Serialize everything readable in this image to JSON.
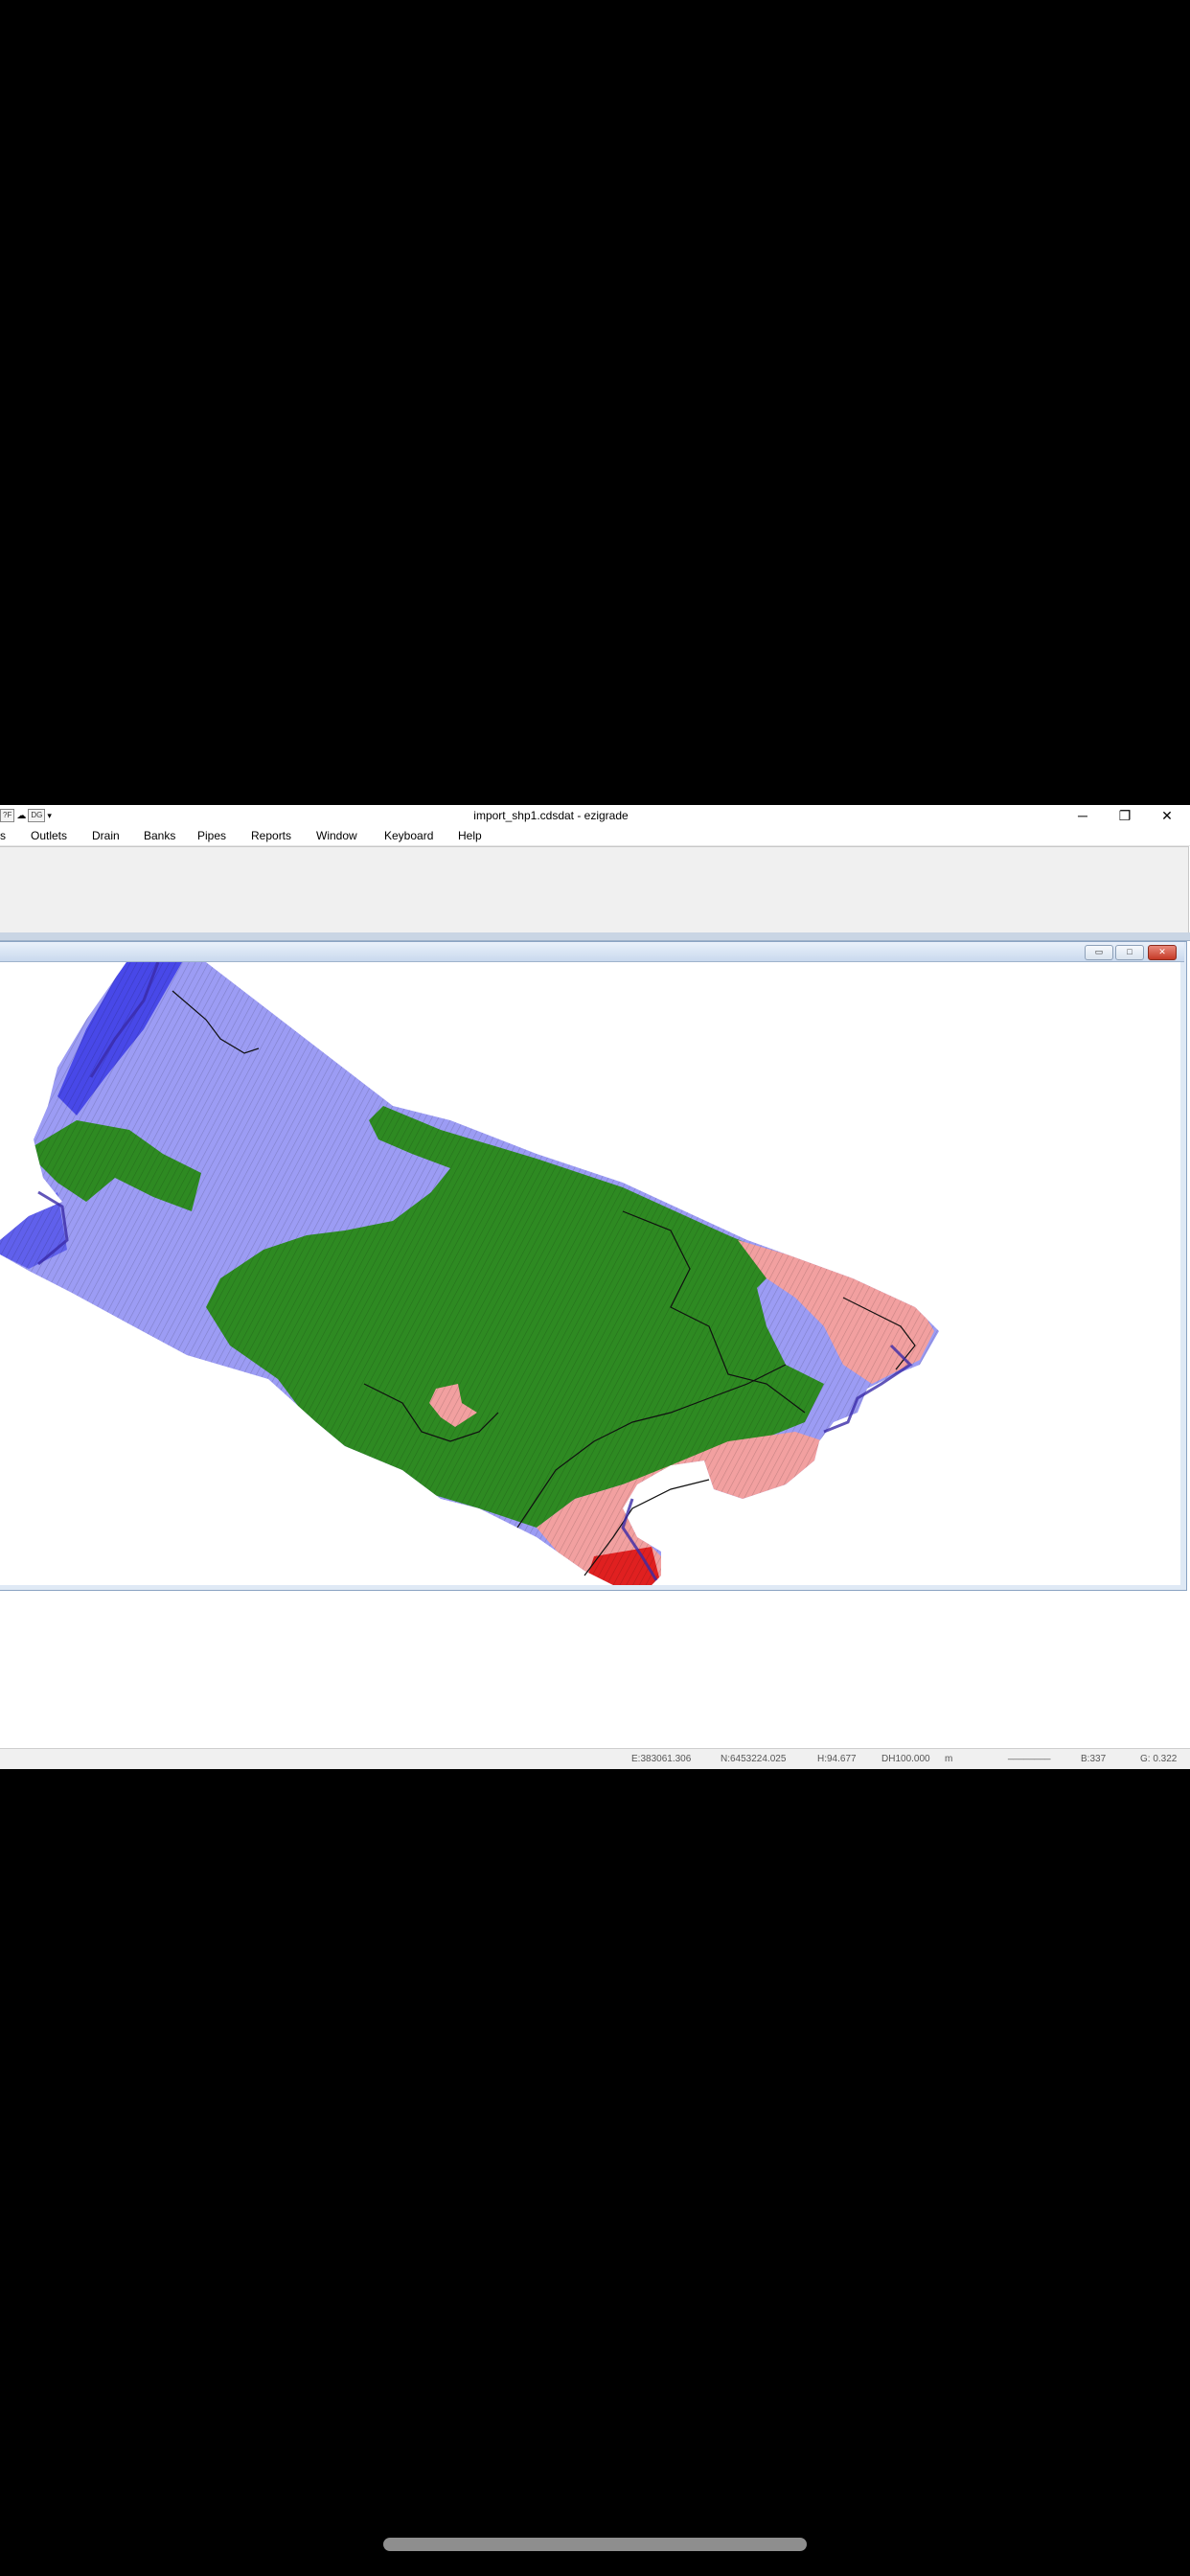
{
  "window": {
    "title": "import_shp1.cdsdat - ezigrade",
    "quick_access": [
      "?F",
      "DG"
    ],
    "controls": {
      "minimize": "─",
      "restore": "❐",
      "close": "✕"
    }
  },
  "menu": [
    "s",
    "Outlets",
    "Drain",
    "Banks",
    "Pipes",
    "Reports",
    "Window",
    "Keyboard",
    "Help"
  ],
  "mdi_controls": {
    "minimize": "▭",
    "maximize": "□",
    "close": "✕"
  },
  "status": {
    "easting": "E:383061.306",
    "northing": "N:6453224.025",
    "height": "H:94.677",
    "dh": "DH100.000",
    "unit": "m",
    "line": "________",
    "b": "B:337",
    "g": "G: 0.322"
  },
  "colors": {
    "low": "#9c9cf4",
    "deep_low": "#2020e0",
    "mid": "#2e8a22",
    "high": "#f2a0a0",
    "peak": "#e02020"
  }
}
